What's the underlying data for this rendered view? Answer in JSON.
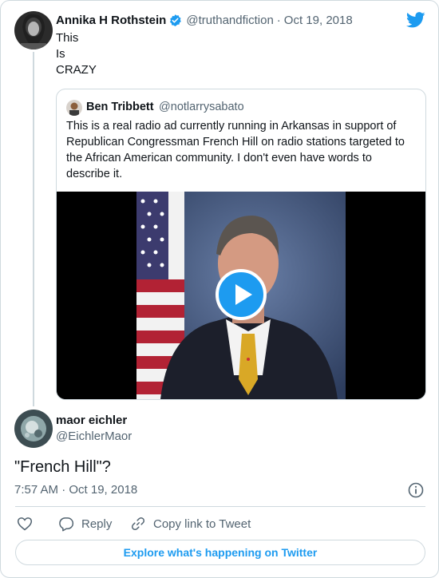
{
  "tweet": {
    "author_name": "Annika H Rothstein",
    "author_handle": "@truthandfiction",
    "separator": "·",
    "date": "Oct 19, 2018",
    "lines": [
      "This",
      "Is",
      "CRAZY"
    ],
    "verified": true,
    "brand_icon": "twitter-bird-icon"
  },
  "quoted_tweet": {
    "author_name": "Ben Tribbett",
    "author_handle": "@notlarrysabato",
    "text": "This is a real radio ad currently running in Arkansas in support of Republican Congressman French Hill on radio stations targeted to the African American community.  I don't even have words to describe it.",
    "media_type": "video",
    "play_icon": "play-icon"
  },
  "reply": {
    "author_name": "maor eichler",
    "author_handle": "@EichlerMaor",
    "text": "\"French Hill\"?",
    "timestamp": "7:57 AM · Oct 19, 2018"
  },
  "actions": {
    "like_icon": "heart-icon",
    "reply_label": "Reply",
    "copy_link_label": "Copy link to Tweet",
    "info_icon": "info-icon"
  },
  "explore_label": "Explore what's happening on Twitter",
  "colors": {
    "accent": "#1d9bf0",
    "text": "#0f1419",
    "muted": "#536471",
    "border": "#cfd9de"
  }
}
